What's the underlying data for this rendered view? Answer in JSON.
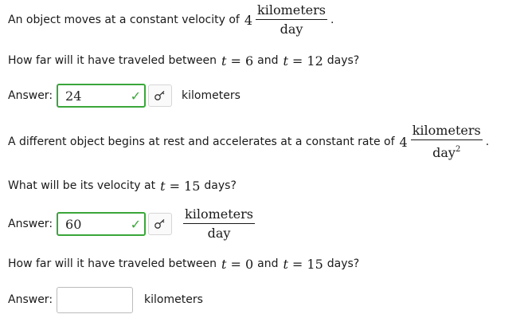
{
  "q1": {
    "text": "An object moves at a constant velocity of",
    "number": "4",
    "frac_num": "kilometers",
    "frac_den": "day",
    "end": "."
  },
  "q2": {
    "text_a": "How far will it have traveled between",
    "var": "t",
    "eq": "= 6",
    "and": "and",
    "var2": "t",
    "eq2": "= 12",
    "text_b": "days?",
    "answer_label": "Answer:",
    "answer_value": "24",
    "unit": "kilometers"
  },
  "q3": {
    "text": "A different object begins at rest and accelerates at a constant rate of",
    "number": "4",
    "frac_num": "kilometers",
    "frac_den": "day",
    "frac_den_exp": "2",
    "end": "."
  },
  "q4": {
    "text_a": "What will be its velocity at",
    "var": "t",
    "eq": "= 15",
    "text_b": "days?",
    "answer_label": "Answer:",
    "answer_value": "60",
    "unit_num": "kilometers",
    "unit_den": "day"
  },
  "q5": {
    "text_a": "How far will it have traveled between",
    "var": "t",
    "eq": "= 0",
    "and": "and",
    "var2": "t",
    "eq2": "= 15",
    "text_b": "days?",
    "answer_label": "Answer:",
    "answer_value": "",
    "unit": "kilometers"
  },
  "icons": {
    "check": "checkmark-icon",
    "key": "key-icon"
  },
  "colors": {
    "correct": "#3aa63a"
  }
}
